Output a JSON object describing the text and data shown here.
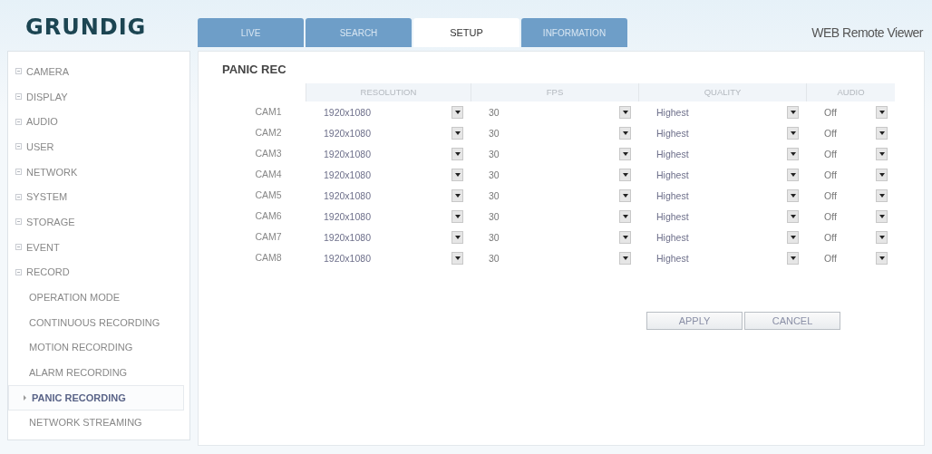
{
  "header": {
    "logo": "GRUNDIG",
    "subtitle": "WEB Remote Viewer"
  },
  "tabs": [
    {
      "label": "LIVE",
      "selected": false
    },
    {
      "label": "SEARCH",
      "selected": false
    },
    {
      "label": "SETUP",
      "selected": true
    },
    {
      "label": "INFORMATION",
      "selected": false
    }
  ],
  "sidebar": {
    "items": [
      {
        "label": "CAMERA"
      },
      {
        "label": "DISPLAY"
      },
      {
        "label": "AUDIO"
      },
      {
        "label": "USER"
      },
      {
        "label": "NETWORK"
      },
      {
        "label": "SYSTEM"
      },
      {
        "label": "STORAGE"
      },
      {
        "label": "EVENT"
      },
      {
        "label": "RECORD",
        "children": [
          {
            "label": "OPERATION MODE",
            "selected": false
          },
          {
            "label": "CONTINUOUS RECORDING",
            "selected": false
          },
          {
            "label": "MOTION RECORDING",
            "selected": false
          },
          {
            "label": "ALARM RECORDING",
            "selected": false
          },
          {
            "label": "PANIC RECORDING",
            "selected": true
          },
          {
            "label": "NETWORK STREAMING",
            "selected": false
          }
        ]
      }
    ]
  },
  "panel": {
    "title": "PANIC REC",
    "table": {
      "columns": [
        "RESOLUTION",
        "FPS",
        "QUALITY",
        "AUDIO"
      ],
      "rows": [
        {
          "camera": "CAM1",
          "resolution": "1920x1080",
          "fps": "30",
          "quality": "Highest",
          "audio": "Off"
        },
        {
          "camera": "CAM2",
          "resolution": "1920x1080",
          "fps": "30",
          "quality": "Highest",
          "audio": "Off"
        },
        {
          "camera": "CAM3",
          "resolution": "1920x1080",
          "fps": "30",
          "quality": "Highest",
          "audio": "Off"
        },
        {
          "camera": "CAM4",
          "resolution": "1920x1080",
          "fps": "30",
          "quality": "Highest",
          "audio": "Off"
        },
        {
          "camera": "CAM5",
          "resolution": "1920x1080",
          "fps": "30",
          "quality": "Highest",
          "audio": "Off"
        },
        {
          "camera": "CAM6",
          "resolution": "1920x1080",
          "fps": "30",
          "quality": "Highest",
          "audio": "Off"
        },
        {
          "camera": "CAM7",
          "resolution": "1920x1080",
          "fps": "30",
          "quality": "Highest",
          "audio": "Off"
        },
        {
          "camera": "CAM8",
          "resolution": "1920x1080",
          "fps": "30",
          "quality": "Highest",
          "audio": "Off"
        }
      ]
    },
    "buttons": [
      "APPLY",
      "CANCEL"
    ]
  }
}
